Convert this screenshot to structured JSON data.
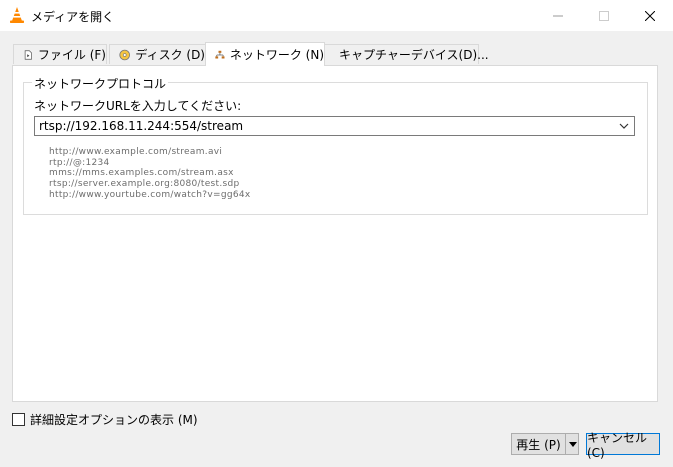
{
  "window": {
    "title": "メディアを開く",
    "controls": {
      "minimize": "minimize",
      "maximize": "maximize",
      "close": "close"
    }
  },
  "tabs": [
    {
      "label": "ファイル (F)",
      "icon": "file-icon",
      "active": false
    },
    {
      "label": "ディスク (D)",
      "icon": "disc-icon",
      "active": false
    },
    {
      "label": "ネットワーク (N)",
      "icon": "network-icon",
      "active": true
    },
    {
      "label": "キャプチャーデバイス(D)...",
      "icon": "capture-device-icon",
      "active": false
    }
  ],
  "network": {
    "group_title": "ネットワークプロトコル",
    "url_label": "ネットワークURLを入力してください:",
    "url_value": "rtsp://192.168.11.244:554/stream",
    "examples": [
      "http://www.example.com/stream.avi",
      "rtp://@:1234",
      "mms://mms.examples.com/stream.asx",
      "rtsp://server.example.org:8080/test.sdp",
      "http://www.yourtube.com/watch?v=gg64x"
    ]
  },
  "footer": {
    "advanced_label": "詳細設定オプションの表示 (M)",
    "advanced_checked": false,
    "play_label": "再生 (P)",
    "cancel_label": "キャンセル (C)"
  },
  "colors": {
    "accent": "#0078d7",
    "vlc_orange": "#ff8800"
  }
}
